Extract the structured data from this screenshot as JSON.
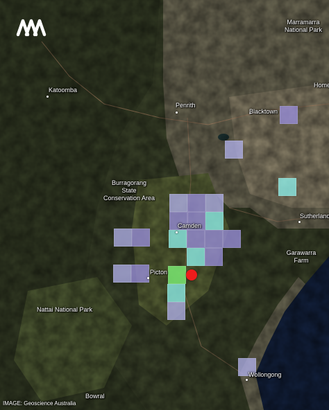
{
  "credit": "IMAGE: Geoscience Australia",
  "logo": "ABC",
  "places": {
    "marramarra": "Marramarra\nNational Park",
    "katoomba": "Katoomba",
    "homebush": "Home",
    "penrith": "Penrith",
    "blacktown": "Blacktown",
    "burragorang": "Burragorang\nState\nConservation Area",
    "camden": "Camden",
    "sutherland": "Sutherland",
    "garawarra": "Garawarra\nFarm",
    "picton": "Picton",
    "nattai": "Nattai National Park",
    "wollongong": "Wollongong",
    "bowral": "Bowral"
  },
  "intensity_colors": {
    "lavender": "#b0b0e8",
    "purple": "#968cd6",
    "cyan": "#8cece6",
    "green": "#78e26e",
    "epicentre": "#ee1c1c"
  },
  "icons": [
    "abc-logo-icon",
    "epicentre-marker-icon"
  ]
}
